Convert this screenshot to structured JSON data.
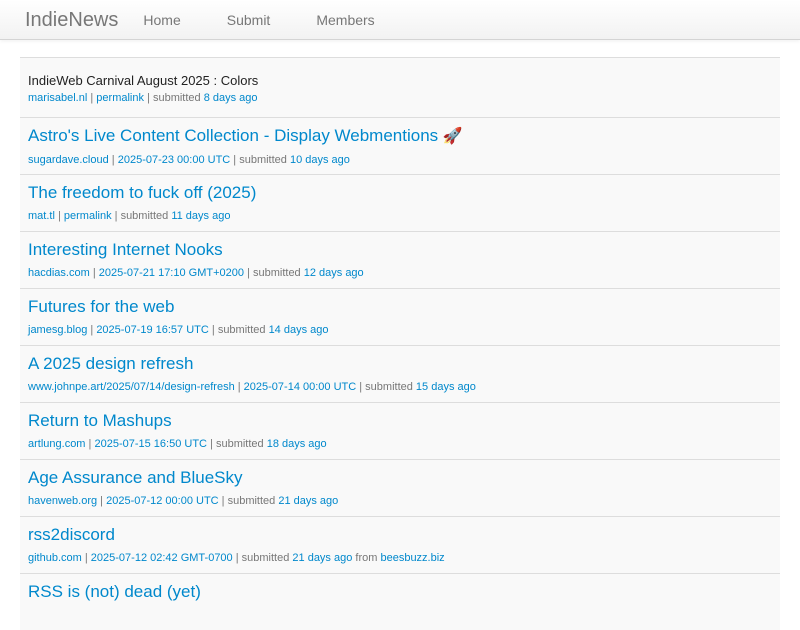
{
  "nav": {
    "brand": "IndieNews",
    "links": [
      "Home",
      "Submit",
      "Members"
    ]
  },
  "colors": {
    "link": "#0088cc",
    "muted": "#777777",
    "row_bg": "#f9f9f9"
  },
  "posts": [
    {
      "title": "IndieWeb Carnival August 2025 : Colors",
      "domain": "marisabel.nl",
      "date": "permalink",
      "submitted": "submitted",
      "ago": "8 days ago",
      "from_label": "",
      "from": ""
    },
    {
      "title": "Astro's Live Content Collection - Display Webmentions",
      "emoji": "🚀",
      "domain": "sugardave.cloud",
      "date": "2025-07-23 00:00 UTC",
      "submitted": "submitted",
      "ago": "10 days ago",
      "from_label": "",
      "from": ""
    },
    {
      "title": "The freedom to fuck off (2025)",
      "domain": "mat.tl",
      "date": "permalink",
      "submitted": "submitted",
      "ago": "11 days ago",
      "from_label": "",
      "from": ""
    },
    {
      "title": "Interesting Internet Nooks",
      "domain": "hacdias.com",
      "date": "2025-07-21 17:10 GMT+0200",
      "submitted": "submitted",
      "ago": "12 days ago",
      "from_label": "",
      "from": ""
    },
    {
      "title": "Futures for the web",
      "domain": "jamesg.blog",
      "date": "2025-07-19 16:57 UTC",
      "submitted": "submitted",
      "ago": "14 days ago",
      "from_label": "",
      "from": ""
    },
    {
      "title": "A 2025 design refresh",
      "domain": "www.johnpe.art/2025/07/14/design-refresh",
      "date": "2025-07-14 00:00 UTC",
      "submitted": "submitted",
      "ago": "15 days ago",
      "from_label": "",
      "from": ""
    },
    {
      "title": "Return to Mashups",
      "domain": "artlung.com",
      "date": "2025-07-15 16:50 UTC",
      "submitted": "submitted",
      "ago": "18 days ago",
      "from_label": "",
      "from": ""
    },
    {
      "title": "Age Assurance and BlueSky",
      "domain": "havenweb.org",
      "date": "2025-07-12 00:00 UTC",
      "submitted": "submitted",
      "ago": "21 days ago",
      "from_label": "",
      "from": ""
    },
    {
      "title": "rss2discord",
      "domain": "github.com",
      "date": "2025-07-12 02:42 GMT-0700",
      "submitted": "submitted",
      "ago": "21 days ago",
      "from_label": "from",
      "from": "beesbuzz.biz"
    },
    {
      "title": "RSS is (not) dead (yet)",
      "domain": "",
      "date": "",
      "submitted": "",
      "ago": "",
      "from_label": "",
      "from": ""
    }
  ]
}
